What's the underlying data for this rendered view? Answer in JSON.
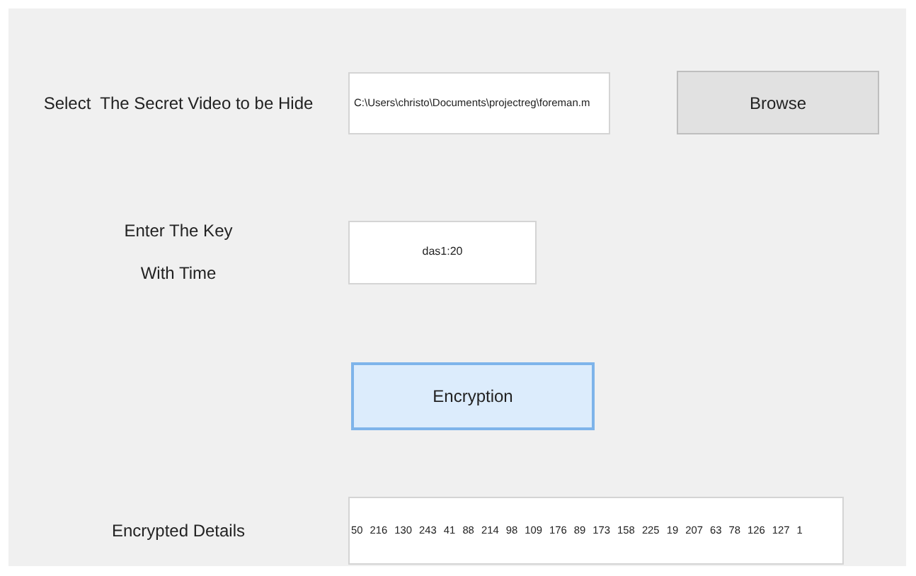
{
  "video_row": {
    "label": "Select  The Secret Video to be Hide",
    "path_value": "C:\\Users\\christo\\Documents\\projectreg\\foreman.m",
    "browse_button": "Browse"
  },
  "key_row": {
    "label_lines": [
      "Enter The Key",
      "With Time"
    ],
    "key_value": "das1:20"
  },
  "encrypt_button": {
    "label": "Encryption",
    "focused": true
  },
  "details_row": {
    "label": "Encrypted Details",
    "value": "50 216 130 243 41 88 214 98 109 176 89 173 158 225 19 207 63 78 126 127 1"
  }
}
